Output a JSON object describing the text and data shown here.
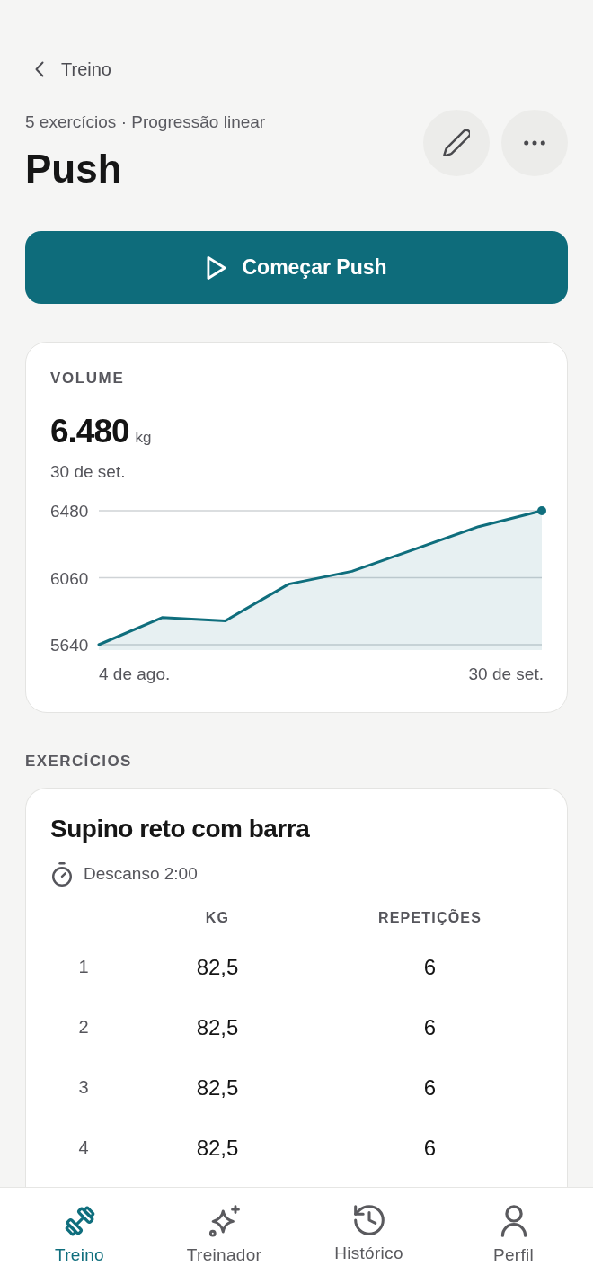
{
  "header": {
    "back_label": "Treino",
    "subtitle": "5 exercícios · Progressão linear",
    "title": "Push"
  },
  "start_button": {
    "label": "Começar Push"
  },
  "volume_card": {
    "label": "VOLUME",
    "value": "6.480",
    "unit": "kg",
    "date": "30 de set.",
    "chart_data": {
      "type": "area",
      "series": [
        {
          "color": "#0f6e7d",
          "values": [
            5640,
            5810,
            5790,
            6020,
            6100,
            6240,
            6380,
            6480
          ]
        }
      ],
      "ylim": [
        5640,
        6480
      ],
      "yticks": [
        5640,
        6060,
        6480
      ]
    },
    "range_start": "4 de ago.",
    "range_end": "30 de set."
  },
  "exercises": {
    "heading": "EXERCÍCIOS",
    "items": [
      {
        "name": "Supino reto com barra",
        "rest": "Descanso 2:00",
        "columns": [
          "KG",
          "REPETIÇÕES"
        ],
        "sets": [
          {
            "number": "1",
            "kg": "82,5",
            "reps": "6"
          },
          {
            "number": "2",
            "kg": "82,5",
            "reps": "6"
          },
          {
            "number": "3",
            "kg": "82,5",
            "reps": "6"
          },
          {
            "number": "4",
            "kg": "82,5",
            "reps": "6"
          }
        ]
      }
    ]
  },
  "tab_bar": {
    "items": [
      {
        "label": "Treino",
        "selected": true
      },
      {
        "label": "Treinador",
        "selected": false
      },
      {
        "label": "Histórico",
        "selected": false
      },
      {
        "label": "Perfil",
        "selected": false
      }
    ]
  }
}
